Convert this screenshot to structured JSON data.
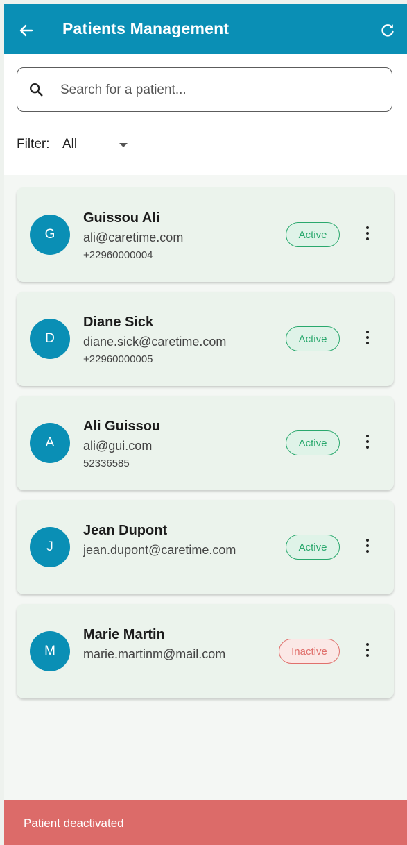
{
  "appbar": {
    "title": "Patients Management",
    "back_icon": "arrow-left-icon",
    "refresh_icon": "refresh-icon"
  },
  "search": {
    "placeholder": "Search for a patient...",
    "value": "",
    "icon": "search-icon"
  },
  "filter": {
    "label": "Filter:",
    "selected": "All"
  },
  "patients": [
    {
      "initial": "G",
      "name": "Guissou Ali",
      "email": "ali@caretime.com",
      "phone": "+22960000004",
      "status": "Active"
    },
    {
      "initial": "D",
      "name": "Diane Sick",
      "email": "diane.sick@caretime.com",
      "phone": "+22960000005",
      "status": "Active"
    },
    {
      "initial": "A",
      "name": "Ali Guissou",
      "email": "ali@gui.com",
      "phone": "52336585",
      "status": "Active"
    },
    {
      "initial": "J",
      "name": "Jean Dupont",
      "email": "jean.dupont@caretime.com",
      "phone": "",
      "status": "Active"
    },
    {
      "initial": "M",
      "name": "Marie Martin",
      "email": "marie.martinm@mail.com",
      "phone": "",
      "status": "Inactive"
    }
  ],
  "snackbar": {
    "message": "Patient deactivated"
  },
  "colors": {
    "primary": "#0a8fb5",
    "active": "#29a86d",
    "inactive": "#e0706c",
    "snackbar": "#dc6b69"
  }
}
